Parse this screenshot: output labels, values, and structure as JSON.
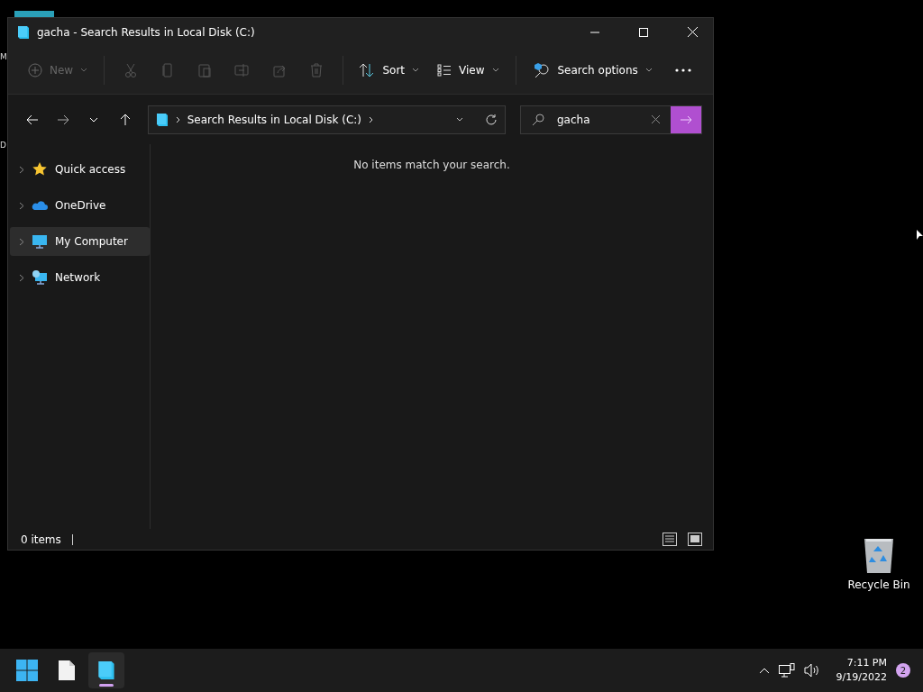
{
  "desktop": {
    "partial_labels": [
      "M",
      "D"
    ],
    "icons": [
      {
        "label": "Recycle Bin",
        "kind": "recycle"
      }
    ]
  },
  "window": {
    "title": "gacha - Search Results in Local Disk (C:)",
    "toolbar": {
      "new": {
        "label": "New",
        "disabled": true
      },
      "actions": [
        {
          "kind": "cut",
          "disabled": true
        },
        {
          "kind": "copy",
          "disabled": true
        },
        {
          "kind": "paste",
          "disabled": true
        },
        {
          "kind": "rename",
          "disabled": true
        },
        {
          "kind": "share",
          "disabled": true
        },
        {
          "kind": "delete",
          "disabled": true
        }
      ],
      "menus": [
        {
          "kind": "sort",
          "label": "Sort"
        },
        {
          "kind": "view",
          "label": "View"
        },
        {
          "kind": "search",
          "label": "Search options"
        }
      ]
    },
    "address": {
      "breadcrumb": "Search Results in Local Disk (C:)"
    },
    "search": {
      "value": "gacha"
    },
    "sidebar": {
      "items": [
        {
          "label": "Quick access",
          "kind": "star",
          "selected": false
        },
        {
          "label": "OneDrive",
          "kind": "cloud",
          "selected": false
        },
        {
          "label": "My Computer",
          "kind": "computer",
          "selected": true
        },
        {
          "label": "Network",
          "kind": "network",
          "selected": false
        }
      ]
    },
    "empty_message": "No items match your search.",
    "status_bar": {
      "count": "0 items",
      "views": [
        {
          "kind": "details"
        },
        {
          "kind": "tiles"
        }
      ]
    }
  },
  "taskbar": {
    "apps": [
      {
        "kind": "start",
        "active": false
      },
      {
        "kind": "file",
        "active": false
      },
      {
        "kind": "explorer",
        "active": true
      }
    ],
    "time": "7:11 PM",
    "date": "9/19/2022",
    "notification_count": "2"
  }
}
